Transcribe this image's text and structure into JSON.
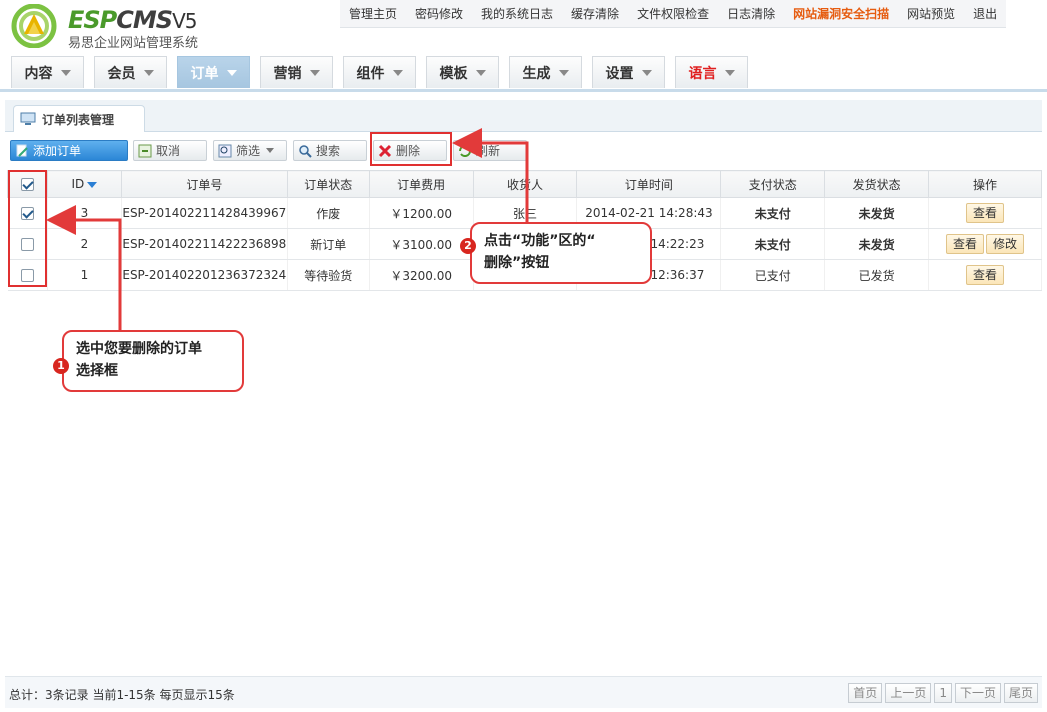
{
  "brand": {
    "name_a": "ESP",
    "name_b": "CMS",
    "version": "V5",
    "subtitle": "易思企业网站管理系统"
  },
  "toplinks": [
    "管理主页",
    "密码修改",
    "我的系统日志",
    "缓存清除",
    "文件权限检查",
    "日志清除",
    "网站漏洞安全扫描",
    "网站预览",
    "退出"
  ],
  "nav": [
    "内容",
    "会员",
    "订单",
    "营销",
    "组件",
    "模板",
    "生成",
    "设置",
    "语言"
  ],
  "panel": {
    "tab_title": "订单列表管理"
  },
  "toolbar": {
    "add": "添加订单",
    "cancel": "取消",
    "filter": "筛选",
    "search": "搜索",
    "delete": "删除",
    "refresh": "刷新"
  },
  "table": {
    "headers": [
      "ID",
      "订单号",
      "订单状态",
      "订单费用",
      "收货人",
      "订单时间",
      "支付状态",
      "发货状态",
      "操作"
    ],
    "rows": [
      {
        "checked": true,
        "id": "3",
        "order_no": "ESP-201402211428439967",
        "status": "作废",
        "fee": "￥1200.00",
        "receiver": "张三",
        "time": "2014-02-21 14:28:43",
        "pay": "未支付",
        "ship": "未发货",
        "actions": [
          "查看"
        ]
      },
      {
        "checked": false,
        "id": "2",
        "order_no": "ESP-201402211422236898",
        "status": "新订单",
        "fee": "￥3100.00",
        "receiver": "",
        "time": "1 14:22:23",
        "pay": "未支付",
        "ship": "未发货",
        "actions": [
          "查看",
          "修改"
        ]
      },
      {
        "checked": false,
        "id": "1",
        "order_no": "ESP-201402201236372324",
        "status": "等待验货",
        "fee": "￥3200.00",
        "receiver": "",
        "time": "0 12:36:37",
        "pay": "已支付",
        "ship": "已发货",
        "actions": [
          "查看"
        ]
      }
    ]
  },
  "annotations": {
    "step1_num": "1",
    "step1_line1": "选中您要删除的订单",
    "step1_line2": "选择框",
    "step2_num": "2",
    "step2_line1": "点击“功能”区的“",
    "step2_line2": "删除”按钮"
  },
  "footer": {
    "info": "总计：3条记录 当前1-15条 每页显示15条",
    "pager": [
      "首页",
      "上一页",
      "1",
      "下一页",
      "尾页"
    ]
  }
}
